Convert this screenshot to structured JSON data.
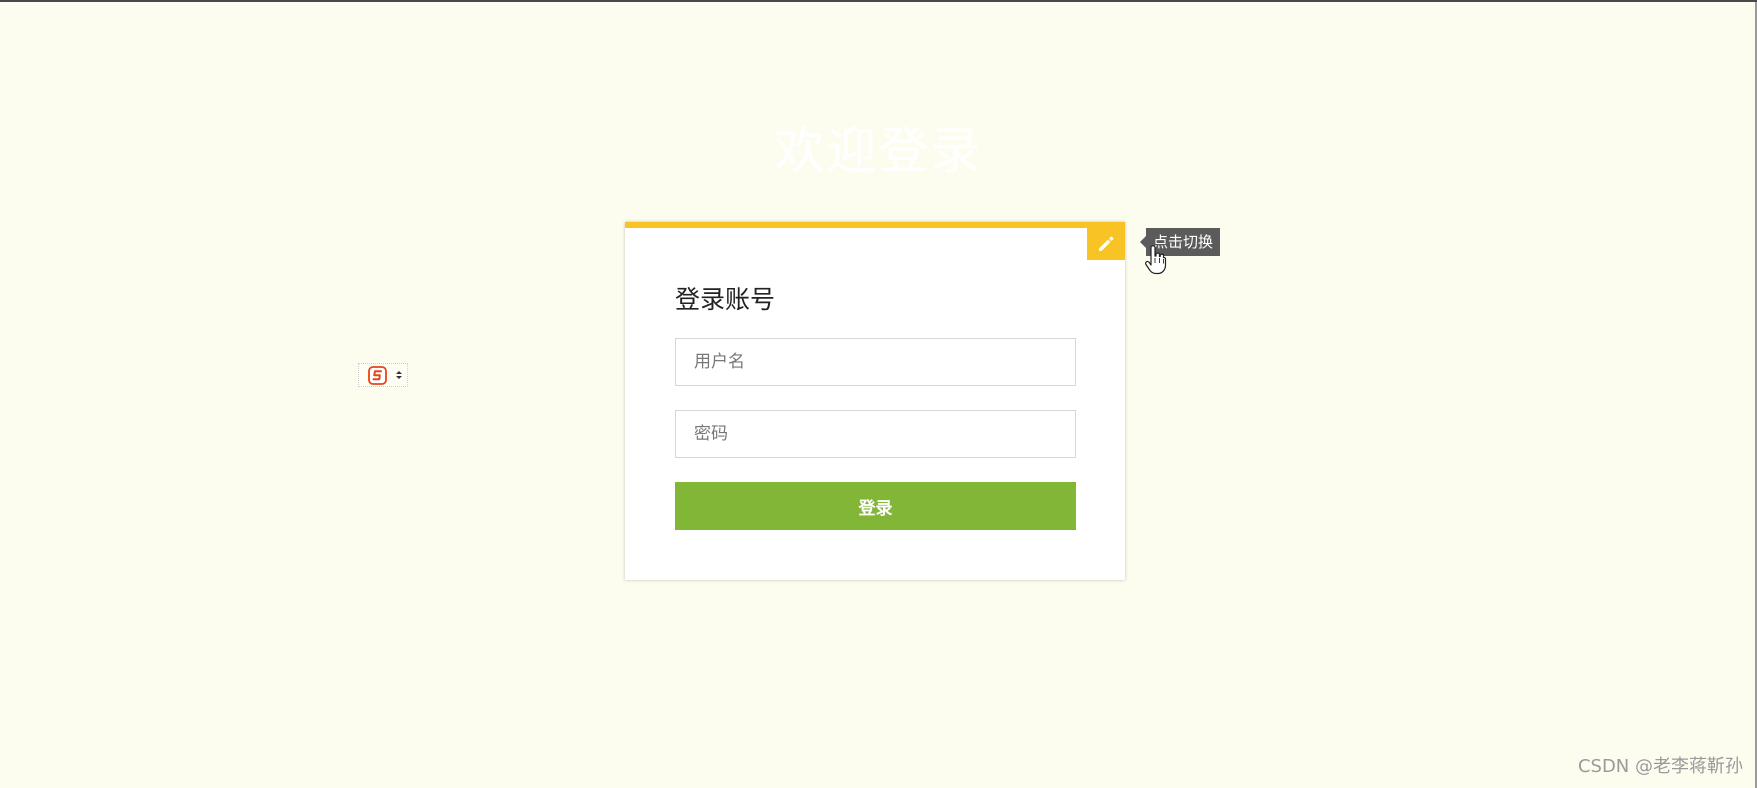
{
  "page": {
    "welcome_title": "欢迎登录"
  },
  "login_card": {
    "heading": "登录账号",
    "username_placeholder": "用户名",
    "username_value": "",
    "password_placeholder": "密码",
    "password_value": "",
    "submit_label": "登录"
  },
  "toggle": {
    "icon": "pencil-icon",
    "tooltip": "点击切换"
  },
  "ime_widget": {
    "icon": "sogou-s-icon"
  },
  "watermark": {
    "text": "CSDN @老李蒋靳孙"
  },
  "colors": {
    "page_background": "#fdfdef",
    "card_accent": "#f7c325",
    "submit_button": "#82b637",
    "tooltip_background": "#5b5b5b"
  }
}
